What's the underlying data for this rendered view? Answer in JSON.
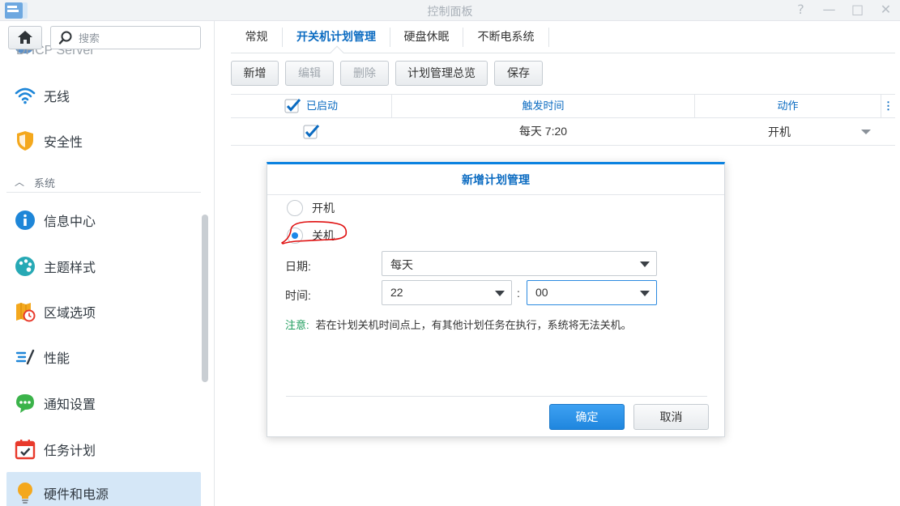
{
  "window": {
    "title": "控制面板",
    "controls": [
      "?",
      "—",
      "□",
      "✕"
    ]
  },
  "sidebar": {
    "search_placeholder": "搜索",
    "partial_item": "DHCP Server",
    "items_top": [
      {
        "label": "无线",
        "icon": "wifi-icon"
      },
      {
        "label": "安全性",
        "icon": "shield-icon"
      }
    ],
    "section": "系统",
    "items": [
      {
        "label": "信息中心",
        "icon": "info-icon"
      },
      {
        "label": "主题样式",
        "icon": "palette-icon"
      },
      {
        "label": "区域选项",
        "icon": "region-map-icon"
      },
      {
        "label": "性能",
        "icon": "performance-icon"
      },
      {
        "label": "通知设置",
        "icon": "notification-icon"
      },
      {
        "label": "任务计划",
        "icon": "calendar-icon"
      },
      {
        "label": "硬件和电源",
        "icon": "bulb-icon",
        "active": true
      }
    ]
  },
  "tabs": [
    "常规",
    "开关机计划管理",
    "硬盘休眠",
    "不断电系统"
  ],
  "active_tab": "开关机计划管理",
  "toolbar": {
    "add": "新增",
    "edit": "编辑",
    "delete": "删除",
    "overview": "计划管理总览",
    "save": "保存"
  },
  "grid": {
    "headers": {
      "enabled": "已启动",
      "trigger_time": "触发时间",
      "action": "动作"
    },
    "rows": [
      {
        "enabled": true,
        "trigger_time": "每天 7:20",
        "action": "开机"
      }
    ]
  },
  "dialog": {
    "title": "新增计划管理",
    "options": {
      "power_on": "开机",
      "power_off": "关机"
    },
    "selected": "关机",
    "date_label": "日期:",
    "date_value": "每天",
    "time_label": "时间:",
    "hour": "22",
    "colon": ":",
    "minute": "00",
    "note_label": "注意:",
    "note_text": "若在计划关机时间点上，有其他计划任务在执行，系统将无法关机。",
    "ok": "确定",
    "cancel": "取消"
  },
  "colors": {
    "accent": "#0b6bc1",
    "primary_button": "#1f86de",
    "note_label": "#1a9b5a",
    "annotation": "#e01010"
  }
}
